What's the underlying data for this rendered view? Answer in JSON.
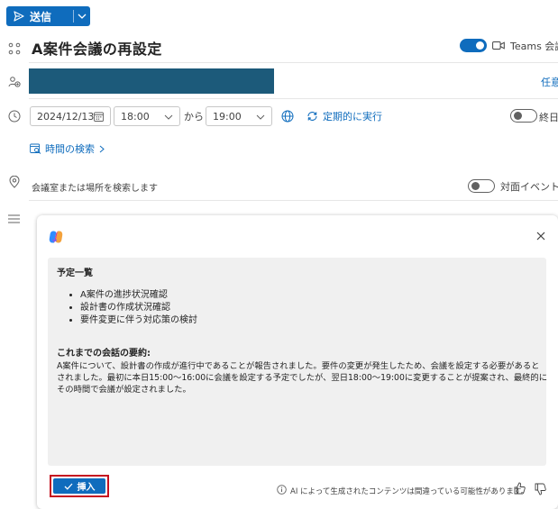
{
  "toolbar": {
    "send_label": "送信"
  },
  "event": {
    "title": "A案件会議の再設定",
    "teams_label": "Teams 会議",
    "attendees_optional_label": "任意"
  },
  "datetime": {
    "date": "2024/12/13",
    "start_time": "18:00",
    "to_label": "から",
    "end_time": "19:00",
    "recurring_label": "定期的に実行",
    "allday_label": "終日",
    "time_search_label": "時間の検索"
  },
  "location": {
    "placeholder": "会議室または場所を検索します",
    "inperson_label": "対面イベント"
  },
  "copilot": {
    "agenda_heading": "予定一覧",
    "agenda_items": [
      "A案件の進捗状況確認",
      "設計書の作成状況確認",
      "要件変更に伴う対応策の検討"
    ],
    "summary_heading": "これまでの会話の要約:",
    "summary_lines": [
      "A案件について、設計書の作成が進行中であることが報告されました。要件の変更が発生したため、会議を設定する必要があると",
      "されました。最初に本日15:00～16:00に会議を設定する予定でしたが、翌日18:00～19:00に変更することが提案され、最終的に",
      "その時間で会議が設定されました。"
    ],
    "insert_label": "挿入",
    "disclaimer": "AI によって生成されたコンテンツは間違っている可能性があります。"
  }
}
